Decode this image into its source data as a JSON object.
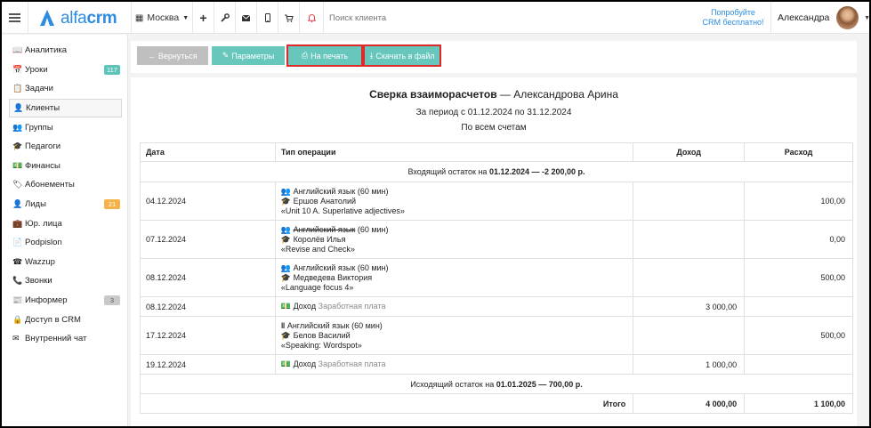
{
  "topbar": {
    "logo": {
      "alfa": "alfa",
      "crm": "crm"
    },
    "city": "Москва",
    "search_placeholder": "Поиск клиента",
    "promo_line1": "Попробуйте",
    "promo_line2": "CRM бесплатно!",
    "user_name": "Александра"
  },
  "sidebar": {
    "items": [
      {
        "label": "Аналитика",
        "icon": "book-icon",
        "badge": ""
      },
      {
        "label": "Уроки",
        "icon": "calendar-icon",
        "badge": "117",
        "badge_color": "#5cc4b8"
      },
      {
        "label": "Задачи",
        "icon": "clipboard-icon",
        "badge": ""
      },
      {
        "label": "Клиенты",
        "icon": "user-icon",
        "badge": "",
        "active": true
      },
      {
        "label": "Группы",
        "icon": "users-icon",
        "badge": ""
      },
      {
        "label": "Педагоги",
        "icon": "graduation-cap-icon",
        "badge": ""
      },
      {
        "label": "Финансы",
        "icon": "money-icon",
        "badge": ""
      },
      {
        "label": "Абонементы",
        "icon": "tag-icon",
        "badge": ""
      },
      {
        "label": "Лиды",
        "icon": "user-plus-icon",
        "badge": "21",
        "badge_color": "#f4b247"
      },
      {
        "label": "Юр. лица",
        "icon": "briefcase-icon",
        "badge": ""
      },
      {
        "label": "Podpislon",
        "icon": "file-icon",
        "badge": ""
      },
      {
        "label": "Wazzup",
        "icon": "whatsapp-icon",
        "badge": ""
      },
      {
        "label": "Звонки",
        "icon": "phone-icon",
        "badge": ""
      },
      {
        "label": "Информер",
        "icon": "newspaper-icon",
        "badge": "3",
        "badge_color": "#c9c9c9"
      },
      {
        "label": "Доступ в CRM",
        "icon": "lock-icon",
        "badge": ""
      },
      {
        "label": "Внутренний чат",
        "icon": "envelope-icon",
        "badge": ""
      }
    ]
  },
  "toolbar": {
    "back": "← Вернуться",
    "params": "Параметры",
    "print": "На печать",
    "download": "Скачать в файл"
  },
  "report": {
    "title_bold": "Сверка взаиморасчетов",
    "title_rest": " — Александрова Арина",
    "period": "За период с 01.12.2024 по 31.12.2024",
    "accounts": "По всем счетам",
    "headers": {
      "date": "Дата",
      "type": "Тип операции",
      "income": "Доход",
      "expense": "Расход"
    },
    "opening": {
      "prefix": "Входящий остаток на ",
      "value": "01.12.2024 — -2 200,00 р."
    },
    "closing": {
      "prefix": "Исходящий остаток на ",
      "value": "01.01.2025 — 700,00 р."
    },
    "rows": [
      {
        "date": "04.12.2024",
        "kind": "lesson",
        "lesson": "Английский язык (60 мин)",
        "teacher": "Ершов Анатолий",
        "topic": "«Unit 10 A. Superlative adjectives»",
        "income": "",
        "expense": "100,00"
      },
      {
        "date": "07.12.2024",
        "kind": "lesson-cancelled",
        "lesson_struck": "Английский язык",
        "lesson_rest": " (60 мин)",
        "teacher": "Королёв Илья",
        "topic": "«Revise and Check»",
        "income": "",
        "expense": "0,00"
      },
      {
        "date": "08.12.2024",
        "kind": "lesson",
        "lesson": "Английский язык (60 мин)",
        "teacher": "Медведева Виктория",
        "topic": "«Language focus 4»",
        "income": "",
        "expense": "500,00"
      },
      {
        "date": "08.12.2024",
        "kind": "payment",
        "label": "Доход",
        "detail": "Заработная плата",
        "income": "3 000,00",
        "expense": ""
      },
      {
        "date": "17.12.2024",
        "kind": "lesson-individual",
        "lesson": "Английский язык (60 мин)",
        "teacher": "Белов Василий",
        "topic": "«Speaking: Wordspot»",
        "income": "",
        "expense": "500,00"
      },
      {
        "date": "19.12.2024",
        "kind": "payment",
        "label": "Доход",
        "detail": "Заработная плата",
        "income": "1 000,00",
        "expense": ""
      }
    ],
    "total": {
      "label": "Итого",
      "income": "4 000,00",
      "expense": "1 100,00"
    }
  }
}
